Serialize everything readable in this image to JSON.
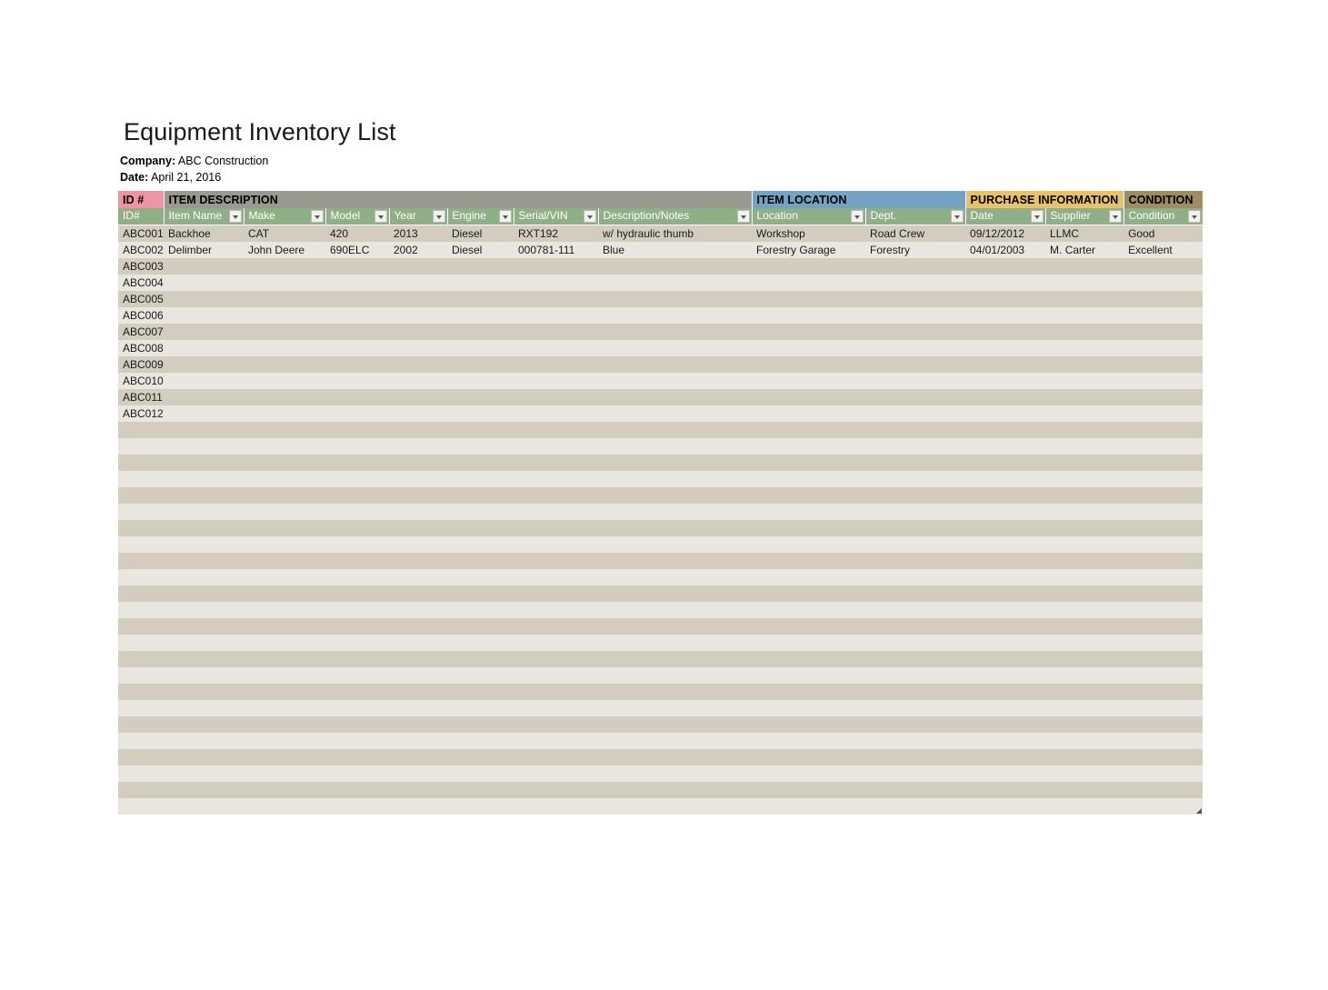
{
  "document": {
    "title": "Equipment Inventory List",
    "company_label": "Company:",
    "company_value": "ABC Construction",
    "date_label": "Date:",
    "date_value": "April 21, 2016"
  },
  "colors": {
    "id_band": "#ef94a2",
    "description_band": "#9a998f",
    "location_band": "#74a2c2",
    "purchase_band": "#e8c268",
    "condition_band": "#9e8c63",
    "filter_header": "#8faf86",
    "row_odd": "#d3cdbf",
    "row_even": "#e9e6e0"
  },
  "table": {
    "group_headers": [
      {
        "label": "ID #",
        "key": "id"
      },
      {
        "label": "ITEM DESCRIPTION",
        "key": "desc"
      },
      {
        "label": "ITEM LOCATION",
        "key": "loc"
      },
      {
        "label": "PURCHASE INFORMATION",
        "key": "pur"
      },
      {
        "label": "CONDITION",
        "key": "con"
      }
    ],
    "columns": [
      {
        "label": "ID#",
        "filter": false
      },
      {
        "label": "Item Name",
        "filter": true
      },
      {
        "label": "Make",
        "filter": true
      },
      {
        "label": "Model",
        "filter": true
      },
      {
        "label": "Year",
        "filter": true
      },
      {
        "label": "Engine",
        "filter": true
      },
      {
        "label": "Serial/VIN",
        "filter": true
      },
      {
        "label": "Description/Notes",
        "filter": true
      },
      {
        "label": "Location",
        "filter": true
      },
      {
        "label": "Dept.",
        "filter": true
      },
      {
        "label": "Date",
        "filter": true
      },
      {
        "label": "Supplier",
        "filter": true
      },
      {
        "label": "Condition",
        "filter": true
      }
    ],
    "rows": [
      [
        "ABC001",
        "Backhoe",
        "CAT",
        "420",
        "2013",
        "Diesel",
        "RXT192",
        "w/ hydraulic thumb",
        "Workshop",
        "Road Crew",
        "09/12/2012",
        "LLMC",
        "Good"
      ],
      [
        "ABC002",
        "Delimber",
        "John Deere",
        "690ELC",
        "2002",
        "Diesel",
        "000781-111",
        "Blue",
        "Forestry Garage",
        "Forestry",
        "04/01/2003",
        "M. Carter",
        "Excellent"
      ],
      [
        "ABC003",
        "",
        "",
        "",
        "",
        "",
        "",
        "",
        "",
        "",
        "",
        "",
        ""
      ],
      [
        "ABC004",
        "",
        "",
        "",
        "",
        "",
        "",
        "",
        "",
        "",
        "",
        "",
        ""
      ],
      [
        "ABC005",
        "",
        "",
        "",
        "",
        "",
        "",
        "",
        "",
        "",
        "",
        "",
        ""
      ],
      [
        "ABC006",
        "",
        "",
        "",
        "",
        "",
        "",
        "",
        "",
        "",
        "",
        "",
        ""
      ],
      [
        "ABC007",
        "",
        "",
        "",
        "",
        "",
        "",
        "",
        "",
        "",
        "",
        "",
        ""
      ],
      [
        "ABC008",
        "",
        "",
        "",
        "",
        "",
        "",
        "",
        "",
        "",
        "",
        "",
        ""
      ],
      [
        "ABC009",
        "",
        "",
        "",
        "",
        "",
        "",
        "",
        "",
        "",
        "",
        "",
        ""
      ],
      [
        "ABC010",
        "",
        "",
        "",
        "",
        "",
        "",
        "",
        "",
        "",
        "",
        "",
        ""
      ],
      [
        "ABC011",
        "",
        "",
        "",
        "",
        "",
        "",
        "",
        "",
        "",
        "",
        "",
        ""
      ],
      [
        "ABC012",
        "",
        "",
        "",
        "",
        "",
        "",
        "",
        "",
        "",
        "",
        "",
        ""
      ],
      [
        "",
        "",
        "",
        "",
        "",
        "",
        "",
        "",
        "",
        "",
        "",
        "",
        ""
      ],
      [
        "",
        "",
        "",
        "",
        "",
        "",
        "",
        "",
        "",
        "",
        "",
        "",
        ""
      ],
      [
        "",
        "",
        "",
        "",
        "",
        "",
        "",
        "",
        "",
        "",
        "",
        "",
        ""
      ],
      [
        "",
        "",
        "",
        "",
        "",
        "",
        "",
        "",
        "",
        "",
        "",
        "",
        ""
      ],
      [
        "",
        "",
        "",
        "",
        "",
        "",
        "",
        "",
        "",
        "",
        "",
        "",
        ""
      ],
      [
        "",
        "",
        "",
        "",
        "",
        "",
        "",
        "",
        "",
        "",
        "",
        "",
        ""
      ],
      [
        "",
        "",
        "",
        "",
        "",
        "",
        "",
        "",
        "",
        "",
        "",
        "",
        ""
      ],
      [
        "",
        "",
        "",
        "",
        "",
        "",
        "",
        "",
        "",
        "",
        "",
        "",
        ""
      ],
      [
        "",
        "",
        "",
        "",
        "",
        "",
        "",
        "",
        "",
        "",
        "",
        "",
        ""
      ],
      [
        "",
        "",
        "",
        "",
        "",
        "",
        "",
        "",
        "",
        "",
        "",
        "",
        ""
      ],
      [
        "",
        "",
        "",
        "",
        "",
        "",
        "",
        "",
        "",
        "",
        "",
        "",
        ""
      ],
      [
        "",
        "",
        "",
        "",
        "",
        "",
        "",
        "",
        "",
        "",
        "",
        "",
        ""
      ],
      [
        "",
        "",
        "",
        "",
        "",
        "",
        "",
        "",
        "",
        "",
        "",
        "",
        ""
      ],
      [
        "",
        "",
        "",
        "",
        "",
        "",
        "",
        "",
        "",
        "",
        "",
        "",
        ""
      ],
      [
        "",
        "",
        "",
        "",
        "",
        "",
        "",
        "",
        "",
        "",
        "",
        "",
        ""
      ],
      [
        "",
        "",
        "",
        "",
        "",
        "",
        "",
        "",
        "",
        "",
        "",
        "",
        ""
      ],
      [
        "",
        "",
        "",
        "",
        "",
        "",
        "",
        "",
        "",
        "",
        "",
        "",
        ""
      ],
      [
        "",
        "",
        "",
        "",
        "",
        "",
        "",
        "",
        "",
        "",
        "",
        "",
        ""
      ],
      [
        "",
        "",
        "",
        "",
        "",
        "",
        "",
        "",
        "",
        "",
        "",
        "",
        ""
      ],
      [
        "",
        "",
        "",
        "",
        "",
        "",
        "",
        "",
        "",
        "",
        "",
        "",
        ""
      ],
      [
        "",
        "",
        "",
        "",
        "",
        "",
        "",
        "",
        "",
        "",
        "",
        "",
        ""
      ],
      [
        "",
        "",
        "",
        "",
        "",
        "",
        "",
        "",
        "",
        "",
        "",
        "",
        ""
      ],
      [
        "",
        "",
        "",
        "",
        "",
        "",
        "",
        "",
        "",
        "",
        "",
        "",
        ""
      ],
      [
        "",
        "",
        "",
        "",
        "",
        "",
        "",
        "",
        "",
        "",
        "",
        "",
        ""
      ]
    ]
  },
  "icons": {
    "filter_dropdown": "chevron-down-icon",
    "resize_handle": "resize-handle-icon"
  }
}
